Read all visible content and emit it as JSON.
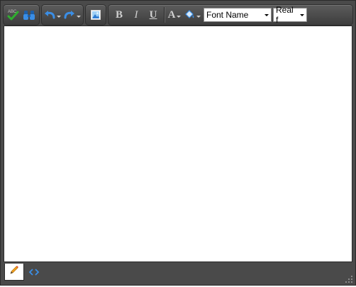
{
  "toolbar": {
    "spellcheck_icon": "spellcheck-icon",
    "find_icon": "binoculars-icon",
    "undo_icon": "undo-icon",
    "redo_icon": "redo-icon",
    "image_icon": "image-manager-icon",
    "bold_label": "B",
    "italic_label": "I",
    "underline_label": "U",
    "forecolor_label": "A",
    "backcolor_icon": "paint-bucket-icon",
    "font_name": {
      "value": "Font Name"
    },
    "font_size": {
      "value": "Real f"
    }
  },
  "content": {
    "text": ""
  },
  "statusbar": {
    "design_mode_icon": "pencil-icon",
    "html_mode_icon": "html-code-icon"
  },
  "colors": {
    "chrome": "#4a4a4a",
    "icon_blue": "#3a8ee6",
    "check_green": "#2fae2f"
  }
}
